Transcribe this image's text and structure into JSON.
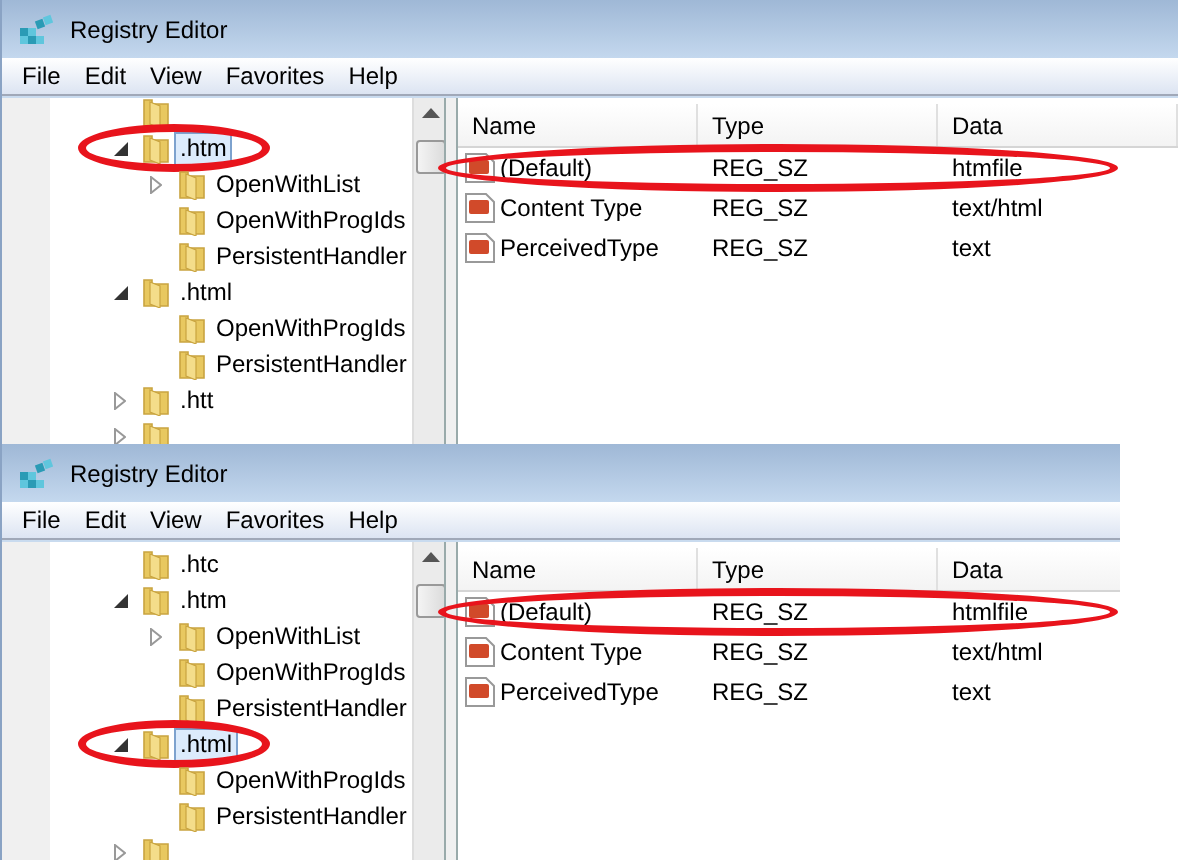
{
  "windows": [
    {
      "title": "Registry Editor",
      "menu": [
        {
          "label": "File"
        },
        {
          "label": "Edit"
        },
        {
          "label": "View"
        },
        {
          "label": "Favorites"
        },
        {
          "label": "Help"
        }
      ],
      "tree": [
        {
          "selected": false,
          "circled": false
        },
        {
          "label": ".htm",
          "expanded": true,
          "selected": true,
          "circled": true,
          "children": [
            {
              "label": "OpenWithList",
              "expanded": false,
              "selected": false,
              "circled": false
            },
            {
              "label": "OpenWithProgIds",
              "selected": false,
              "circled": false
            },
            {
              "label": "PersistentHandler",
              "selected": false,
              "circled": false
            }
          ]
        },
        {
          "label": ".html",
          "expanded": true,
          "selected": false,
          "circled": false,
          "children": [
            {
              "label": "OpenWithProgIds",
              "selected": false,
              "circled": false
            },
            {
              "label": "PersistentHandler",
              "selected": false,
              "circled": false
            }
          ]
        },
        {
          "label": ".htt",
          "expanded": false,
          "selected": false,
          "circled": false
        },
        {
          "expanded": false,
          "selected": false,
          "circled": false
        }
      ],
      "columns": [
        "Name",
        "Type",
        "Data"
      ],
      "rows": [
        {
          "name": "(Default)",
          "type": "REG_SZ",
          "data": "htmfile",
          "circled": true
        },
        {
          "name": "Content Type",
          "type": "REG_SZ",
          "data": "text/html",
          "circled": false
        },
        {
          "name": "PerceivedType",
          "type": "REG_SZ",
          "data": "text",
          "circled": false
        }
      ]
    },
    {
      "title": "Registry Editor",
      "menu": [
        {
          "label": "File"
        },
        {
          "label": "Edit"
        },
        {
          "label": "View"
        },
        {
          "label": "Favorites"
        },
        {
          "label": "Help"
        }
      ],
      "tree": [
        {
          "label": ".htc",
          "selected": false,
          "circled": false
        },
        {
          "label": ".htm",
          "expanded": true,
          "selected": false,
          "circled": false,
          "children": [
            {
              "label": "OpenWithList",
              "expanded": false,
              "selected": false,
              "circled": false
            },
            {
              "label": "OpenWithProgIds",
              "selected": false,
              "circled": false
            },
            {
              "label": "PersistentHandler",
              "selected": false,
              "circled": false
            }
          ]
        },
        {
          "label": ".html",
          "expanded": true,
          "selected": true,
          "circled": true,
          "children": [
            {
              "label": "OpenWithProgIds",
              "selected": false,
              "circled": false
            },
            {
              "label": "PersistentHandler",
              "selected": false,
              "circled": false
            }
          ]
        },
        {
          "expanded": false,
          "selected": false,
          "circled": false
        }
      ],
      "columns": [
        "Name",
        "Type",
        "Data"
      ],
      "rows": [
        {
          "name": "(Default)",
          "type": "REG_SZ",
          "data": "htmlfile",
          "circled": true
        },
        {
          "name": "Content Type",
          "type": "REG_SZ",
          "data": "text/html",
          "circled": false
        },
        {
          "name": "PerceivedType",
          "type": "REG_SZ",
          "data": "text",
          "circled": false
        }
      ]
    }
  ]
}
